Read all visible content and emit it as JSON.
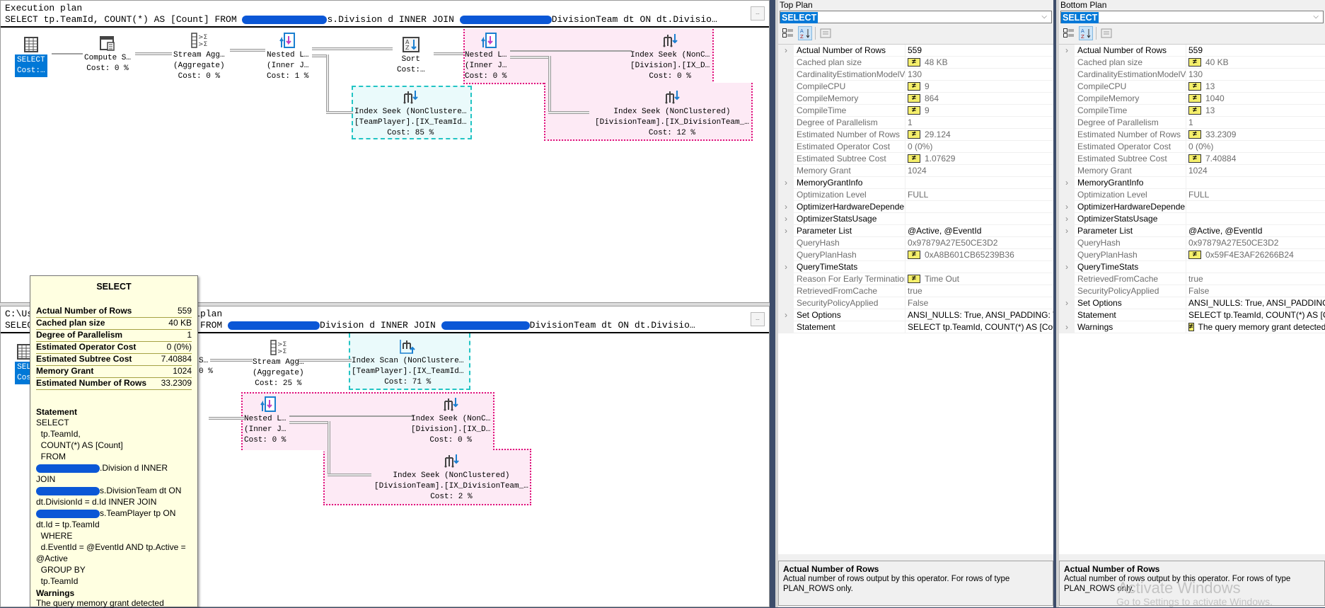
{
  "top_plan": {
    "header_line1": "Execution plan",
    "header_line2_a": "SELECT tp.TeamId, COUNT(*) AS [Count] FROM ",
    "header_line2_b": "s.Division d INNER JOIN ",
    "header_line2_c": "DivisionTeam dt ON dt.Divisio…",
    "more_button": "…",
    "nodes": {
      "select": {
        "l1": "SELECT",
        "l2": "Cost:…"
      },
      "compute": {
        "l1": "Compute S…",
        "l2": "Cost: 0 %"
      },
      "stream_agg": {
        "l1": "Stream Agg…",
        "l2": "(Aggregate)",
        "l3": "Cost: 0 %"
      },
      "nested1": {
        "l1": "Nested L…",
        "l2": "(Inner J…",
        "l3": "Cost: 1 %"
      },
      "sort": {
        "l1": "Sort",
        "l2": "Cost:…"
      },
      "nested2": {
        "l1": "Nested L…",
        "l2": "(Inner J…",
        "l3": "Cost: 0 %"
      },
      "seek_division": {
        "l1": "Index Seek (NonC…",
        "l2": "[Division].[IX_D…",
        "l3": "Cost: 0 %"
      },
      "seek_teamplayer": {
        "l1": "Index Seek (NonClustere…",
        "l2": "[TeamPlayer].[IX_TeamId…",
        "l3": "Cost: 85 %"
      },
      "seek_divisionteam": {
        "l1": "Index Seek (NonClustered)",
        "l2": "[DivisionTeam].[IX_DivisionTeam_…",
        "l3": "Cost: 12 %"
      }
    }
  },
  "bottom_plan": {
    "header_line1_a": "C:\\Us",
    "header_line1_b": "n.sqlplan",
    "header_line2_a": "SELEC",
    "header_line2_b": "unt] FROM ",
    "header_line2_c": "Division d INNER JOIN ",
    "header_line2_d": "DivisionTeam dt ON dt.Divisio…",
    "more_button": "…",
    "nodes": {
      "select": {
        "l1": "SEL",
        "l2": "Cos"
      },
      "compute": {
        "l1": "S…",
        "l2": "0 %"
      },
      "stream_agg": {
        "l1": "Stream Agg…",
        "l2": "(Aggregate)",
        "l3": "Cost: 25 %"
      },
      "scan_teamplayer": {
        "l1": "Index Scan (NonClustere…",
        "l2": "[TeamPlayer].[IX_TeamId…",
        "l3": "Cost: 71 %"
      },
      "nested": {
        "l1": "Nested L…",
        "l2": "(Inner J…",
        "l3": "Cost: 0 %"
      },
      "seek_division": {
        "l1": "Index Seek (NonC…",
        "l2": "[Division].[IX_D…",
        "l3": "Cost: 0 %"
      },
      "seek_divisionteam": {
        "l1": "Index Seek (NonClustered)",
        "l2": "[DivisionTeam].[IX_DivisionTeam_…",
        "l3": "Cost: 2 %"
      }
    }
  },
  "tooltip": {
    "title": "SELECT",
    "rows": [
      {
        "k": "Actual Number of Rows",
        "v": "559"
      },
      {
        "k": "Cached plan size",
        "v": "40 KB"
      },
      {
        "k": "Degree of Parallelism",
        "v": "1"
      },
      {
        "k": "Estimated Operator Cost",
        "v": "0 (0%)"
      },
      {
        "k": "Estimated Subtree Cost",
        "v": "7.40884"
      },
      {
        "k": "Memory Grant",
        "v": "1024"
      },
      {
        "k": "Estimated Number of Rows",
        "v": "33.2309"
      }
    ],
    "statement_label": "Statement",
    "statement_lines": [
      "SELECT",
      "  tp.TeamId,",
      "  COUNT(*) AS [Count]",
      "  FROM",
      "[REDACTED].Division d INNER",
      "JOIN",
      "[REDACTED]s.DivisionTeam dt ON",
      "dt.DivisionId = d.Id INNER JOIN",
      "[REDACTED]s.TeamPlayer tp ON",
      "dt.Id = tp.TeamId",
      "  WHERE",
      "  d.EventId = @EventId AND tp.Active =",
      "@Active",
      "  GROUP BY",
      "  tp.TeamId"
    ],
    "warnings_label": "Warnings",
    "warnings_text": "The query memory grant detected"
  },
  "props_top": {
    "title": "Top Plan",
    "selected": "SELECT",
    "rows": [
      {
        "exp": true,
        "name": "Actual Number of Rows",
        "val": "559",
        "neq": false,
        "dim": false
      },
      {
        "exp": false,
        "name": "Cached plan size",
        "val": "48 KB",
        "neq": true,
        "dim": true
      },
      {
        "exp": false,
        "name": "CardinalityEstimationModelVersion",
        "val": "130",
        "neq": false,
        "dim": true
      },
      {
        "exp": false,
        "name": "CompileCPU",
        "val": "9",
        "neq": true,
        "dim": true
      },
      {
        "exp": false,
        "name": "CompileMemory",
        "val": "864",
        "neq": true,
        "dim": true
      },
      {
        "exp": false,
        "name": "CompileTime",
        "val": "9",
        "neq": true,
        "dim": true
      },
      {
        "exp": false,
        "name": "Degree of Parallelism",
        "val": "1",
        "neq": false,
        "dim": true
      },
      {
        "exp": false,
        "name": "Estimated Number of Rows",
        "val": "29.124",
        "neq": true,
        "dim": true
      },
      {
        "exp": false,
        "name": "Estimated Operator Cost",
        "val": "0 (0%)",
        "neq": false,
        "dim": true
      },
      {
        "exp": false,
        "name": "Estimated Subtree Cost",
        "val": "1.07629",
        "neq": true,
        "dim": true
      },
      {
        "exp": false,
        "name": "Memory Grant",
        "val": "1024",
        "neq": false,
        "dim": true
      },
      {
        "exp": true,
        "name": "MemoryGrantInfo",
        "val": "",
        "neq": false,
        "dim": false
      },
      {
        "exp": false,
        "name": "Optimization Level",
        "val": "FULL",
        "neq": false,
        "dim": true
      },
      {
        "exp": true,
        "name": "OptimizerHardwareDependentPro",
        "val": "",
        "neq": false,
        "dim": false
      },
      {
        "exp": true,
        "name": "OptimizerStatsUsage",
        "val": "",
        "neq": false,
        "dim": false
      },
      {
        "exp": true,
        "name": "Parameter List",
        "val": "@Active, @EventId",
        "neq": false,
        "dim": false
      },
      {
        "exp": false,
        "name": "QueryHash",
        "val": "0x97879A27E50CE3D2",
        "neq": false,
        "dim": true
      },
      {
        "exp": false,
        "name": "QueryPlanHash",
        "val": "0xA8B601CB65239B36",
        "neq": true,
        "dim": true
      },
      {
        "exp": true,
        "name": "QueryTimeStats",
        "val": "",
        "neq": false,
        "dim": false
      },
      {
        "exp": false,
        "name": "Reason For Early Termination Of S",
        "val": "Time Out",
        "neq": true,
        "dim": true
      },
      {
        "exp": false,
        "name": "RetrievedFromCache",
        "val": "true",
        "neq": false,
        "dim": true
      },
      {
        "exp": false,
        "name": "SecurityPolicyApplied",
        "val": "False",
        "neq": false,
        "dim": true
      },
      {
        "exp": true,
        "name": "Set Options",
        "val": "ANSI_NULLS: True, ANSI_PADDING: Tru",
        "neq": false,
        "dim": false
      },
      {
        "exp": false,
        "name": "Statement",
        "val": "SELECT  tp.TeamId,  COUNT(*) AS [Coun",
        "neq": false,
        "dim": false
      }
    ],
    "help_title": "Actual Number of Rows",
    "help_text": "Actual number of rows output by this operator. For rows of type PLAN_ROWS only."
  },
  "props_bottom": {
    "title": "Bottom Plan",
    "selected": "SELECT",
    "rows": [
      {
        "exp": true,
        "name": "Actual Number of Rows",
        "val": "559",
        "neq": false,
        "dim": false
      },
      {
        "exp": false,
        "name": "Cached plan size",
        "val": "40 KB",
        "neq": true,
        "dim": true
      },
      {
        "exp": false,
        "name": "CardinalityEstimationModelVersio",
        "val": "130",
        "neq": false,
        "dim": true
      },
      {
        "exp": false,
        "name": "CompileCPU",
        "val": "13",
        "neq": true,
        "dim": true
      },
      {
        "exp": false,
        "name": "CompileMemory",
        "val": "1040",
        "neq": true,
        "dim": true
      },
      {
        "exp": false,
        "name": "CompileTime",
        "val": "13",
        "neq": true,
        "dim": true
      },
      {
        "exp": false,
        "name": "Degree of Parallelism",
        "val": "1",
        "neq": false,
        "dim": true
      },
      {
        "exp": false,
        "name": "Estimated Number of Rows",
        "val": "33.2309",
        "neq": true,
        "dim": true
      },
      {
        "exp": false,
        "name": "Estimated Operator Cost",
        "val": "0 (0%)",
        "neq": false,
        "dim": true
      },
      {
        "exp": false,
        "name": "Estimated Subtree Cost",
        "val": "7.40884",
        "neq": true,
        "dim": true
      },
      {
        "exp": false,
        "name": "Memory Grant",
        "val": "1024",
        "neq": false,
        "dim": true
      },
      {
        "exp": true,
        "name": "MemoryGrantInfo",
        "val": "",
        "neq": false,
        "dim": false
      },
      {
        "exp": false,
        "name": "Optimization Level",
        "val": "FULL",
        "neq": false,
        "dim": true
      },
      {
        "exp": true,
        "name": "OptimizerHardwareDependentPro",
        "val": "",
        "neq": false,
        "dim": false
      },
      {
        "exp": true,
        "name": "OptimizerStatsUsage",
        "val": "",
        "neq": false,
        "dim": false
      },
      {
        "exp": true,
        "name": "Parameter List",
        "val": "@Active, @EventId",
        "neq": false,
        "dim": false
      },
      {
        "exp": false,
        "name": "QueryHash",
        "val": "0x97879A27E50CE3D2",
        "neq": false,
        "dim": true
      },
      {
        "exp": false,
        "name": "QueryPlanHash",
        "val": "0x59F4E3AF26266B24",
        "neq": true,
        "dim": true
      },
      {
        "exp": true,
        "name": "QueryTimeStats",
        "val": "",
        "neq": false,
        "dim": false
      },
      {
        "exp": false,
        "name": "RetrievedFromCache",
        "val": "true",
        "neq": false,
        "dim": true
      },
      {
        "exp": false,
        "name": "SecurityPolicyApplied",
        "val": "False",
        "neq": false,
        "dim": true
      },
      {
        "exp": true,
        "name": "Set Options",
        "val": "ANSI_NULLS: True, ANSI_PADDING: Tr",
        "neq": false,
        "dim": false
      },
      {
        "exp": false,
        "name": "Statement",
        "val": "SELECT  tp.TeamId,  COUNT(*) AS [Cou",
        "neq": false,
        "dim": false
      },
      {
        "exp": true,
        "name": "Warnings",
        "val": "The query memory grant detected \"",
        "neq": true,
        "dim": false
      }
    ],
    "help_title": "Actual Number of Rows",
    "help_text": "Actual number of rows output by this operator. For rows of type PLAN_ROWS only."
  },
  "watermark": {
    "line1": "Activate Windows",
    "line2": "Go to Settings to activate Windows."
  },
  "neq_symbol": "≠",
  "expand_symbol": "›",
  "combo_chevron": "⌵"
}
